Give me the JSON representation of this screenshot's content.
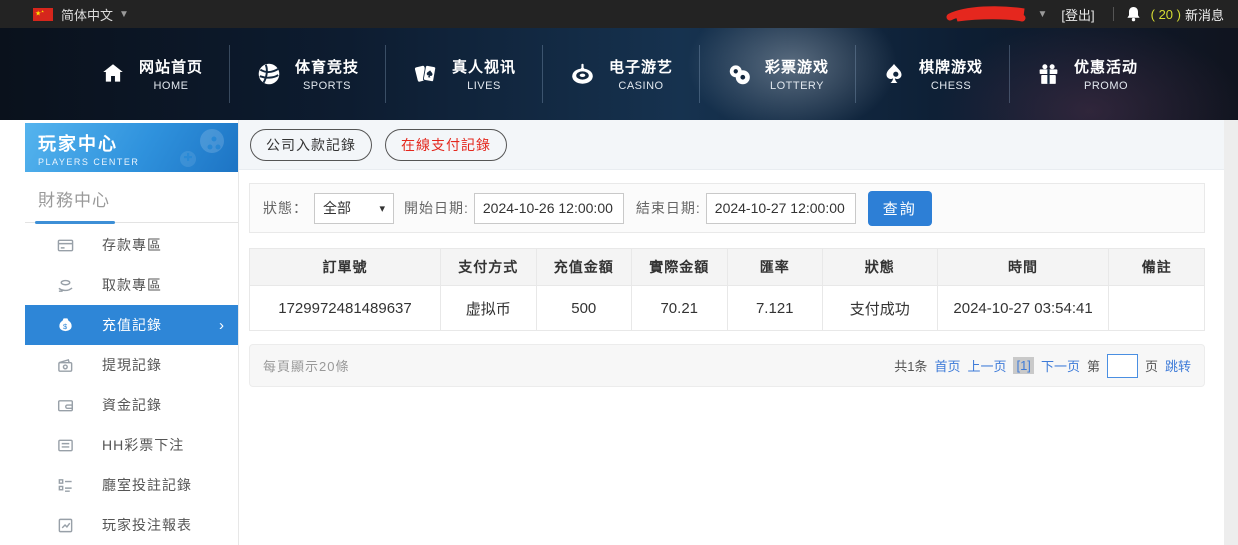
{
  "topbar": {
    "language": "简体中文",
    "logout": "[登出]",
    "messages_count": "( 20 )",
    "messages_label": "新消息"
  },
  "nav": {
    "items": [
      {
        "zh": "网站首页",
        "en": "HOME"
      },
      {
        "zh": "体育竞技",
        "en": "SPORTS"
      },
      {
        "zh": "真人视讯",
        "en": "LIVES"
      },
      {
        "zh": "电子游艺",
        "en": "CASINO"
      },
      {
        "zh": "彩票游戏",
        "en": "LOTTERY"
      },
      {
        "zh": "棋牌游戏",
        "en": "CHESS"
      },
      {
        "zh": "优惠活动",
        "en": "PROMO"
      }
    ]
  },
  "sidebar": {
    "title": "玩家中心",
    "subtitle": "PLAYERS CENTER",
    "section": "財務中心",
    "items": [
      {
        "label": "存款專區",
        "active": false
      },
      {
        "label": "取款專區",
        "active": false
      },
      {
        "label": "充值記錄",
        "active": true
      },
      {
        "label": "提現記錄",
        "active": false
      },
      {
        "label": "資金記錄",
        "active": false
      },
      {
        "label": "HH彩票下注",
        "active": false
      },
      {
        "label": "廳室投註記錄",
        "active": false
      },
      {
        "label": "玩家投注報表",
        "active": false
      }
    ]
  },
  "tabs": [
    {
      "label": "公司入款記錄",
      "active": false
    },
    {
      "label": "在線支付記錄",
      "active": true
    }
  ],
  "filters": {
    "status_label": "狀態：",
    "status_value": "全部",
    "start_label": "開始日期:",
    "start_value": "2024-10-26 12:00:00",
    "end_label": "結束日期:",
    "end_value": "2024-10-27 12:00:00",
    "search_button": "查詢"
  },
  "table": {
    "headers": [
      "訂單號",
      "支付方式",
      "充值金額",
      "實際金額",
      "匯率",
      "狀態",
      "時間",
      "備註"
    ],
    "rows": [
      [
        "1729972481489637",
        "虚拟币",
        "500",
        "70.21",
        "7.121",
        "支付成功",
        "2024-10-27 03:54:41",
        ""
      ]
    ]
  },
  "pagination": {
    "page_size": "每頁顯示20條",
    "total": "共1条",
    "first": "首页",
    "prev": "上一页",
    "current": "[1]",
    "next": "下一页",
    "jump_prefix": "第",
    "jump_suffix": "页",
    "jump_button": "跳转"
  },
  "colors": {
    "accent_blue": "#2e86d7",
    "link_blue": "#3e7bd8",
    "active_tab_red": "#e4281e",
    "message_count_yellow": "#d5dc33",
    "topbar_bg": "#232323"
  }
}
